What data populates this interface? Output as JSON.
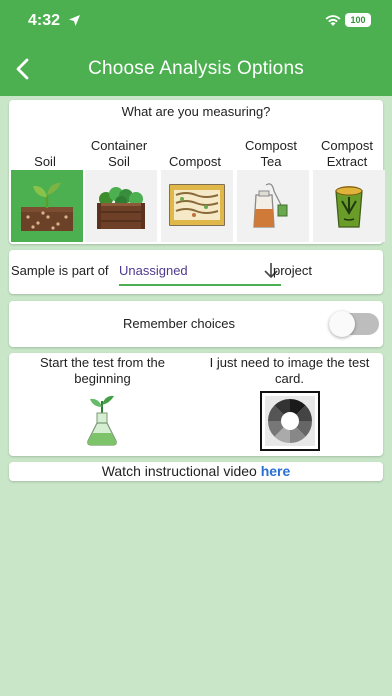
{
  "status_bar": {
    "time": "4:32",
    "battery": "100"
  },
  "header": {
    "title": "Choose Analysis Options"
  },
  "measure": {
    "question": "What are you measuring?",
    "options": [
      {
        "label": "Soil",
        "icon": "seedling-soil-icon",
        "selected": true
      },
      {
        "label": "Container Soil",
        "icon": "planter-box-icon",
        "selected": false
      },
      {
        "label": "Compost",
        "icon": "compost-bin-icon",
        "selected": false
      },
      {
        "label": "Compost Tea",
        "icon": "tea-bag-icon",
        "selected": false
      },
      {
        "label": "Compost Extract",
        "icon": "extract-bucket-icon",
        "selected": false
      }
    ]
  },
  "project": {
    "prefix": "Sample is part of",
    "value": "Unassigned",
    "suffix": "project"
  },
  "remember": {
    "label": "Remember choices",
    "on": false
  },
  "start": {
    "options": [
      {
        "label": "Start the test from the beginning",
        "icon": "flask-plant-icon"
      },
      {
        "label": "I just need to image the test card.",
        "icon": "test-card-icon"
      }
    ]
  },
  "video": {
    "text": "Watch instructional video",
    "link": "here"
  },
  "colors": {
    "header": "#4caf50",
    "background": "#c9e6c8",
    "accent": "#4caf50",
    "link": "#2a6fd1"
  }
}
